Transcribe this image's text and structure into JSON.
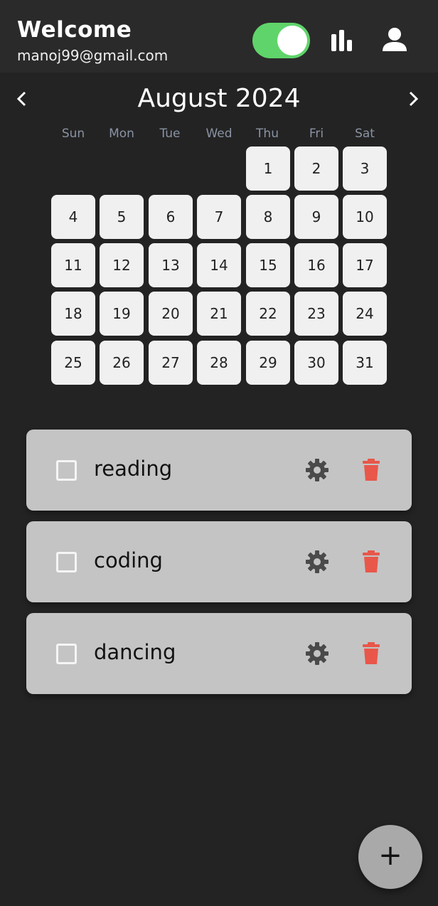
{
  "header": {
    "title": "Welcome",
    "email": "manoj99@gmail.com",
    "toggle_on": true,
    "accent_color": "#5fd46a"
  },
  "calendar": {
    "month_title": "August 2024",
    "weekdays": [
      "Sun",
      "Mon",
      "Tue",
      "Wed",
      "Thu",
      "Fri",
      "Sat"
    ],
    "first_weekday_index": 4,
    "days": [
      "1",
      "2",
      "3",
      "4",
      "5",
      "6",
      "7",
      "8",
      "9",
      "10",
      "11",
      "12",
      "13",
      "14",
      "15",
      "16",
      "17",
      "18",
      "19",
      "20",
      "21",
      "22",
      "23",
      "24",
      "25",
      "26",
      "27",
      "28",
      "29",
      "30",
      "31"
    ]
  },
  "tasks": [
    {
      "name": "reading",
      "checked": false
    },
    {
      "name": "coding",
      "checked": false
    },
    {
      "name": "dancing",
      "checked": false
    }
  ],
  "icons": {
    "stats": "bar-chart-icon",
    "profile": "person-icon",
    "prev": "chevron-left-icon",
    "next": "chevron-right-icon",
    "settings": "gear-icon",
    "delete": "trash-icon",
    "add": "plus-icon"
  },
  "colors": {
    "background": "#232323",
    "card": "#c4c4c4",
    "delete": "#e8574a",
    "gear": "#4a4a4a",
    "fab": "#a9a9a9"
  },
  "fab": {
    "label": "+"
  }
}
